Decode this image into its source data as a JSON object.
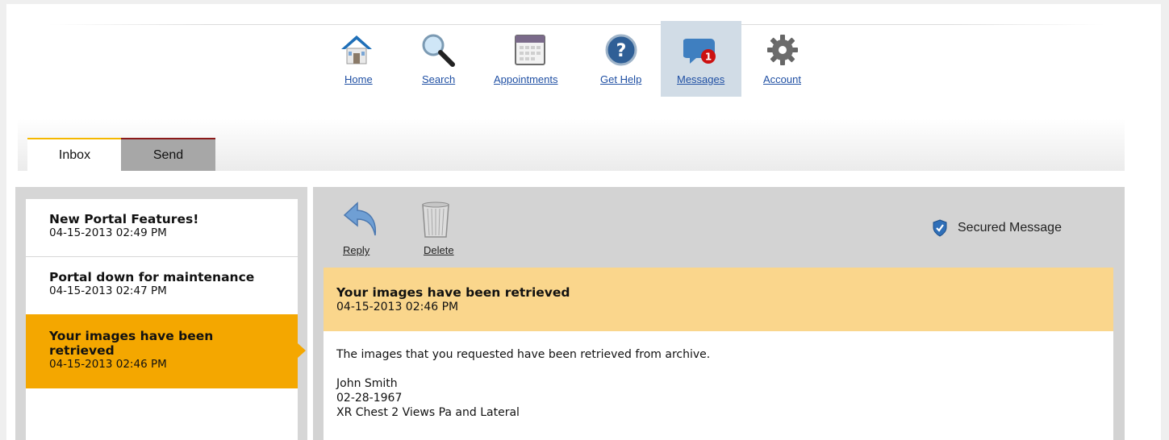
{
  "nav": {
    "items": [
      {
        "label": "Home",
        "icon": "house-icon"
      },
      {
        "label": "Search",
        "icon": "magnifier-icon"
      },
      {
        "label": "Appointments",
        "icon": "calendar-icon"
      },
      {
        "label": "Get Help",
        "icon": "help-icon"
      },
      {
        "label": "Messages",
        "icon": "chat-bubble-icon",
        "badge": "1",
        "active": true
      },
      {
        "label": "Account",
        "icon": "gear-icon"
      }
    ]
  },
  "tabs": [
    {
      "label": "Inbox",
      "active": true
    },
    {
      "label": "Send",
      "active": false
    }
  ],
  "messages": [
    {
      "title": "New Portal Features!",
      "date": "04-15-2013 02:49 PM"
    },
    {
      "title": "Portal down for maintenance",
      "date": "04-15-2013 02:47 PM"
    },
    {
      "title": "Your images have been retrieved",
      "title_line1": "Your images have been",
      "title_line2": "retrieved",
      "date": "04-15-2013 02:46 PM",
      "selected": true
    }
  ],
  "toolbar": {
    "reply_label": "Reply",
    "delete_label": "Delete",
    "secured_label": "Secured Message"
  },
  "message_view": {
    "title": "Your images have been retrieved",
    "date": "04-15-2013 02:46 PM",
    "body": "The images that you requested have been retrieved from archive.",
    "patient_name": "John Smith",
    "patient_dob": "02-28-1967",
    "exam": "XR Chest 2 Views Pa and Lateral"
  },
  "colors": {
    "link": "#1f4fa3",
    "accent": "#f4a700",
    "message_header": "#fad68c",
    "active_nav": "#d1dce6",
    "badge": "#cc1111"
  }
}
